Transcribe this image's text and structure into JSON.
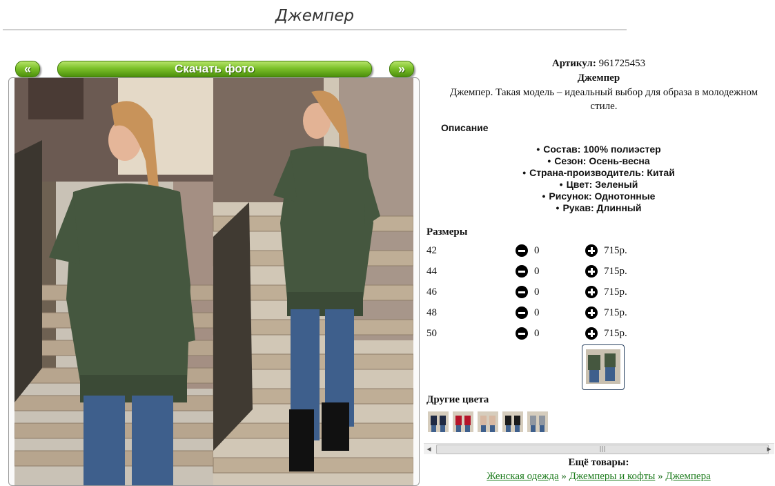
{
  "page": {
    "title": "Джемпер"
  },
  "gallery": {
    "prev_label": "«",
    "download_label": "Скачать фото",
    "next_label": "»"
  },
  "product": {
    "article_label": "Артикул:",
    "article_value": "961725453",
    "name": "Джемпер",
    "description": "Джемпер. Такая модель – идеальный выбор для образа в молодежном стиле.",
    "description_heading": "Описание",
    "features": [
      "Состав: 100% полиэстер",
      "Сезон: Осень-весна",
      "Страна-производитель: Китай",
      "Цвет: Зеленый",
      "Рисунок: Однотонные",
      "Рукав: Длинный"
    ]
  },
  "sizes": {
    "heading": "Размеры",
    "rows": [
      {
        "size": "42",
        "qty": "0",
        "price": "715р."
      },
      {
        "size": "44",
        "qty": "0",
        "price": "715р."
      },
      {
        "size": "46",
        "qty": "0",
        "price": "715р."
      },
      {
        "size": "48",
        "qty": "0",
        "price": "715р."
      },
      {
        "size": "50",
        "qty": "0",
        "price": "715р."
      }
    ]
  },
  "other_colors": {
    "heading": "Другие цвета",
    "swatches": [
      "#1f2a44",
      "#b5142a",
      "#d7b8a2",
      "#1b1b1b",
      "#8f96a0"
    ]
  },
  "scrollbar": {
    "left_icon": "◀",
    "right_icon": "▶",
    "grip": "|||"
  },
  "more": {
    "heading": "Ещё товары:",
    "breadcrumbs": [
      "Женская одежда",
      "Джемперы и кофты",
      "Джемпера"
    ],
    "separator": "»"
  },
  "colors": {
    "accent_green": "#6bb320",
    "sweater_green": "#45573f",
    "jeans_blue": "#3e5f8c"
  }
}
